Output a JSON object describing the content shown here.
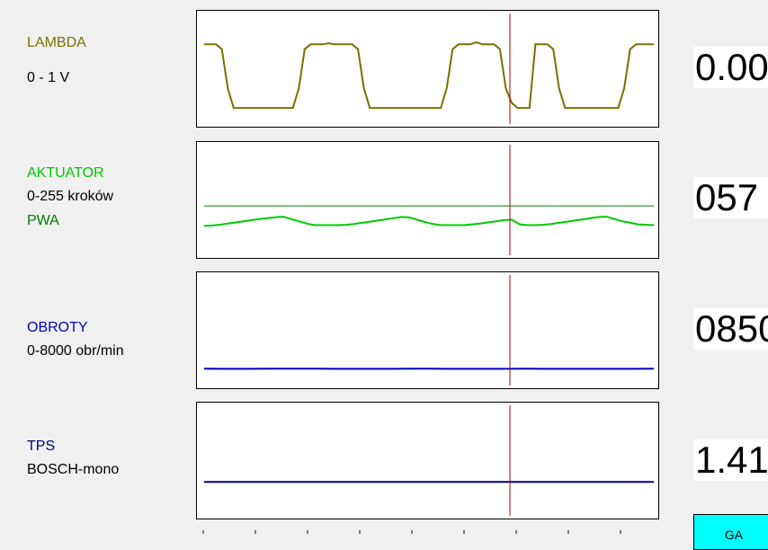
{
  "colors": {
    "lambda": "#7a7000",
    "aktuator": "#00c800",
    "pwa": "#007a00",
    "obroty": "#0000c0",
    "tps": "#00007a",
    "cursor": "#b00000",
    "button": "#00ffff"
  },
  "channels": [
    {
      "name": "LAMBDA",
      "range": "0 - 1 V",
      "value": "0.00"
    },
    {
      "name": "AKTUATOR",
      "range": "0-255 kroków",
      "extra": "PWA",
      "value": "057"
    },
    {
      "name": "OBROTY",
      "range": "0-8000 obr/min",
      "value": "0850"
    },
    {
      "name": "TPS",
      "range": "BOSCH-mono",
      "value": "1.41"
    }
  ],
  "button_label": "GA",
  "chart_data": [
    {
      "type": "line",
      "series": [
        {
          "values": [
            0.75,
            0.75,
            0.75,
            0.7,
            0.3,
            0.1,
            0.1,
            0.1,
            0.1,
            0.1,
            0.1,
            0.1,
            0.1,
            0.1,
            0.1,
            0.1,
            0.3,
            0.7,
            0.75,
            0.75,
            0.75,
            0.76,
            0.75,
            0.75,
            0.75,
            0.75,
            0.7,
            0.3,
            0.1,
            0.1,
            0.1,
            0.1,
            0.1,
            0.1,
            0.1,
            0.1,
            0.1,
            0.1,
            0.1,
            0.1,
            0.1,
            0.3,
            0.7,
            0.75,
            0.75,
            0.75,
            0.77,
            0.75,
            0.75,
            0.75,
            0.7,
            0.3,
            0.15,
            0.1,
            0.1,
            0.1,
            0.75,
            0.75,
            0.75,
            0.7,
            0.3,
            0.1,
            0.1,
            0.1,
            0.1,
            0.1,
            0.1,
            0.1,
            0.1,
            0.1,
            0.1,
            0.3,
            0.7,
            0.75,
            0.75,
            0.75,
            0.75
          ]
        }
      ],
      "ylim": [
        0,
        1
      ]
    },
    {
      "type": "line",
      "series": [
        {
          "values": [
            60,
            61,
            63,
            66,
            69,
            72,
            75,
            78,
            80,
            82,
            84,
            78,
            72,
            66,
            62,
            62,
            62,
            62,
            63,
            65,
            68,
            71,
            74,
            77,
            80,
            83,
            82,
            76,
            70,
            65,
            62,
            62,
            62,
            62,
            64,
            66,
            69,
            72,
            75,
            76,
            64,
            62,
            62,
            63,
            65,
            68,
            71,
            74,
            77,
            80,
            83,
            84,
            78,
            72,
            68,
            64,
            63,
            62
          ]
        },
        {
          "values": [
            112,
            112
          ]
        }
      ],
      "ylim": [
        0,
        255
      ]
    },
    {
      "type": "line",
      "series": [
        {
          "values": [
            860,
            850,
            850,
            855,
            860,
            860,
            860,
            860,
            850,
            850,
            850,
            850,
            855,
            860,
            860,
            855,
            850,
            850,
            850,
            850,
            860,
            855,
            855,
            850,
            850,
            850,
            855,
            855,
            860
          ]
        }
      ],
      "ylim": [
        0,
        8000
      ]
    },
    {
      "type": "line",
      "series": [
        {
          "values": [
            1.41,
            1.41
          ]
        }
      ],
      "ylim": [
        0,
        5
      ]
    }
  ]
}
